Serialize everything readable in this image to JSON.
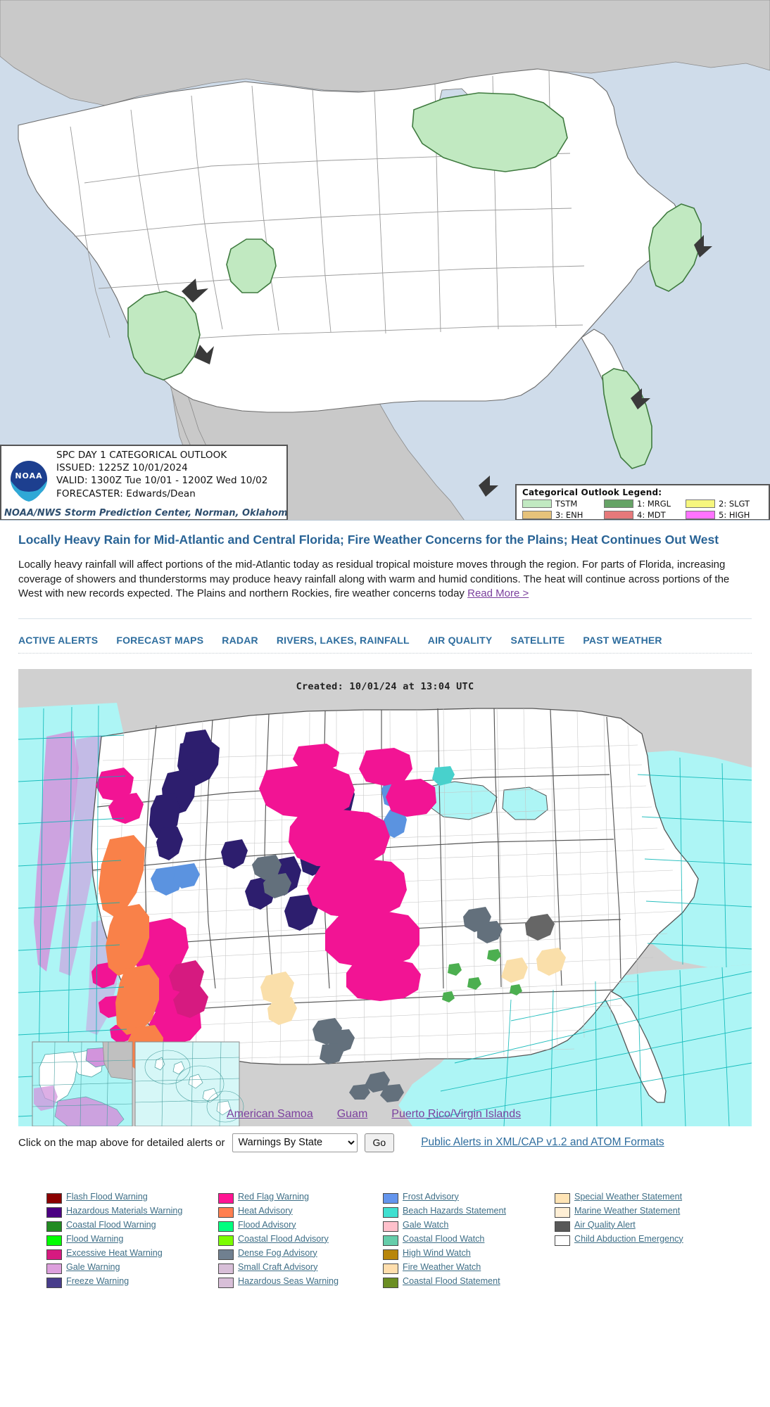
{
  "spc_map": {
    "header": {
      "title": "SPC DAY 1 CATEGORICAL OUTLOOK",
      "issued": "ISSUED: 1225Z 10/01/2024",
      "valid": "VALID: 1300Z Tue 10/01 - 1200Z Wed 10/02",
      "forecaster": "FORECASTER: Edwards/Dean",
      "agency": "NOAA/NWS Storm Prediction Center, Norman, Oklahoma",
      "logo_text": "NOAA"
    },
    "legend": {
      "title": "Categorical Outlook Legend:",
      "items": [
        {
          "label": "TSTM",
          "color": "#c1e9c1"
        },
        {
          "label": "1: MRGL",
          "color": "#66a366"
        },
        {
          "label": "2: SLGT",
          "color": "#f6f67e"
        },
        {
          "label": "3: ENH",
          "color": "#e6c27a"
        },
        {
          "label": "4: MDT",
          "color": "#e6797a"
        },
        {
          "label": "5: HIGH",
          "color": "#ff73ff"
        }
      ]
    },
    "colors": {
      "ocean": "#cfdcea",
      "foreign_land": "#c9c9c9",
      "us_land": "#ffffff",
      "tstm_fill": "#c1e9c1",
      "tstm_stroke": "#3f7a3f",
      "border": "#6b6b6b"
    }
  },
  "headline": {
    "title": "Locally Heavy Rain for Mid-Atlantic and Central Florida; Fire Weather Concerns for the Plains; Heat Continues Out West",
    "body": "Locally heavy rainfall will affect portions of the mid-Atlantic today as residual tropical moisture moves through the region. For parts of Florida, increasing coverage of showers and thunderstorms may produce heavy rainfall along with warm and humid conditions. The heat will continue across portions of the West with new records expected. The Plains and northern Rockies, fire weather concerns today ",
    "read_more": "Read More >"
  },
  "nav": {
    "tabs": [
      {
        "label": "ACTIVE ALERTS"
      },
      {
        "label": "FORECAST MAPS"
      },
      {
        "label": "RADAR"
      },
      {
        "label": "RIVERS, LAKES, RAINFALL"
      },
      {
        "label": "AIR QUALITY"
      },
      {
        "label": "SATELLITE"
      },
      {
        "label": "PAST WEATHER"
      }
    ]
  },
  "alerts_map": {
    "created": "Created: 10/01/24 at 13:04 UTC",
    "territory_links": [
      {
        "label": "American Samoa"
      },
      {
        "label": "Guam"
      },
      {
        "label": "Puerto Rico/Virgin Islands"
      }
    ],
    "colors": {
      "background": "#d0d0d0",
      "marine_cyan": "#adf5f5",
      "marine_violet": "#d294dc",
      "land_white": "#ffffff",
      "county_line": "#c4c4c4",
      "state_line": "#555555",
      "red_flag": "#f21494",
      "freeze": "#2d1e6e",
      "frost": "#5b93e0",
      "heat_adv": "#f98149",
      "dense_fog": "#63707c",
      "fire_wx_watch": "#fadfaa",
      "special_wx": "#fadfaa",
      "air_quality": "#666666",
      "beach_hazards": "#48d1cc",
      "coastal_flood_watch": "#63cfa3"
    }
  },
  "controls": {
    "label": "Click on the map above for detailed alerts or",
    "select_value": "Warnings By State",
    "select_options": [
      "Warnings By State"
    ],
    "go_label": "Go",
    "cap_link": "Public Alerts in XML/CAP v1.2 and ATOM Formats"
  },
  "legend_columns": [
    {
      "items": [
        {
          "label": "Flash Flood Warning",
          "color": "#8b0000"
        },
        {
          "label": "Hazardous Materials Warning",
          "color": "#4b0082"
        },
        {
          "label": "Coastal Flood Warning",
          "color": "#228b22"
        },
        {
          "label": "Flood Warning",
          "color": "#00ff00"
        },
        {
          "label": "Excessive Heat Warning",
          "color": "#d61a80"
        },
        {
          "label": "Gale Warning",
          "color": "#dda0dd"
        },
        {
          "label": "Freeze Warning",
          "color": "#483d8b"
        }
      ]
    },
    {
      "items": [
        {
          "label": "Red Flag Warning",
          "color": "#ff1493"
        },
        {
          "label": "Heat Advisory",
          "color": "#ff7f50"
        },
        {
          "label": "Flood Advisory",
          "color": "#00ff7f"
        },
        {
          "label": "Coastal Flood Advisory",
          "color": "#7cfc00"
        },
        {
          "label": "Dense Fog Advisory",
          "color": "#708090"
        },
        {
          "label": "Small Craft Advisory",
          "color": "#d8bfd8"
        },
        {
          "label": "Hazardous Seas Warning",
          "color": "#d8bfd8"
        }
      ]
    },
    {
      "items": [
        {
          "label": "Frost Advisory",
          "color": "#6495ed"
        },
        {
          "label": "Beach Hazards Statement",
          "color": "#40e0d0"
        },
        {
          "label": "Gale Watch",
          "color": "#ffc0cb"
        },
        {
          "label": "Coastal Flood Watch",
          "color": "#66cdaa"
        },
        {
          "label": "High Wind Watch",
          "color": "#b8860b"
        },
        {
          "label": "Fire Weather Watch",
          "color": "#ffdead"
        },
        {
          "label": "Coastal Flood Statement",
          "color": "#6b8e23"
        }
      ]
    },
    {
      "items": [
        {
          "label": "Special Weather Statement",
          "color": "#ffe4b5"
        },
        {
          "label": "Marine Weather Statement",
          "color": "#ffefd5"
        },
        {
          "label": "Air Quality Alert",
          "color": "#585858"
        },
        {
          "label": "Child Abduction Emergency",
          "color": "#ffffff"
        }
      ]
    }
  ]
}
